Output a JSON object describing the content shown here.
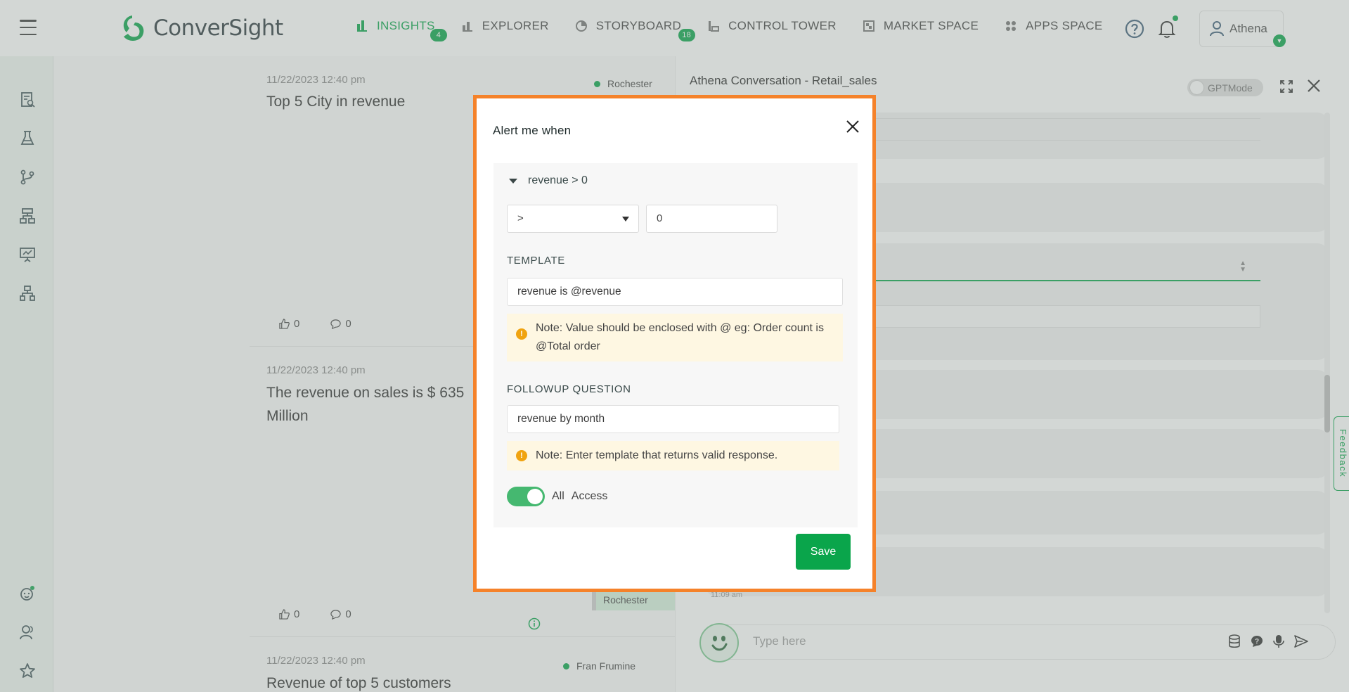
{
  "header": {
    "brand": "ConverSight",
    "nav": [
      {
        "label": "INSIGHTS",
        "badge": "4",
        "active": true,
        "icon": "insights-bar-icon"
      },
      {
        "label": "EXPLORER",
        "badge": "",
        "active": false,
        "icon": "explorer-bar-icon"
      },
      {
        "label": "STORYBOARD",
        "badge": "18",
        "active": false,
        "icon": "storyboard-icon"
      },
      {
        "label": "CONTROL TOWER",
        "badge": "",
        "active": false,
        "icon": "control-tower-icon"
      },
      {
        "label": "MARKET SPACE",
        "badge": "",
        "active": false,
        "icon": "market-space-icon"
      },
      {
        "label": "APPS SPACE",
        "badge": "",
        "active": false,
        "icon": "apps-space-icon"
      }
    ],
    "user": "Athena"
  },
  "sidebar": {
    "icons": [
      "document-search-icon",
      "flask-icon",
      "branch-icon",
      "hierarchy-icon",
      "presentation-icon",
      "sitemap-icon",
      "bot-settings-icon",
      "user-group-icon",
      "star-icon"
    ]
  },
  "feed": {
    "cards": [
      {
        "date": "11/22/2023 12:40 pm",
        "title": "Top 5 City in revenue",
        "location": "Rochester",
        "likes": "0",
        "comments": "0"
      },
      {
        "date": "11/22/2023 12:40 pm",
        "title": "The revenue on sales is $ 635 Million",
        "location": "",
        "likes": "0",
        "comments": "0"
      },
      {
        "date": "11/22/2023 12:40 pm",
        "title": "Revenue of top 5 customers",
        "location": "Fran Frumine",
        "likes": "",
        "comments": ""
      }
    ],
    "chip": "Rochester"
  },
  "conversation": {
    "title": "Athena Conversation - Retail_sales",
    "gpt_mode": "GPTMode",
    "input_placeholder": "Type here",
    "feedback": "Feedback",
    "time_fragment": "11:09 am"
  },
  "modal": {
    "title": "Alert me when",
    "condition_summary": "revenue > 0",
    "operator": ">",
    "value": "0",
    "template_label": "TEMPLATE",
    "template_value": "revenue is @revenue",
    "template_note": "Note: Value should be enclosed with @ eg: Order count is @Total order",
    "followup_label": "FOLLOWUP QUESTION",
    "followup_value": "revenue by month",
    "followup_note": "Note: Enter template that returns valid response.",
    "access_all": "All",
    "access_label": "Access",
    "access_enabled": true,
    "save_label": "Save"
  },
  "colors": {
    "brand_green": "#0aa54b",
    "modal_border": "#f5822a",
    "note_background": "#fef7e2",
    "warning": "#f0a30f"
  }
}
